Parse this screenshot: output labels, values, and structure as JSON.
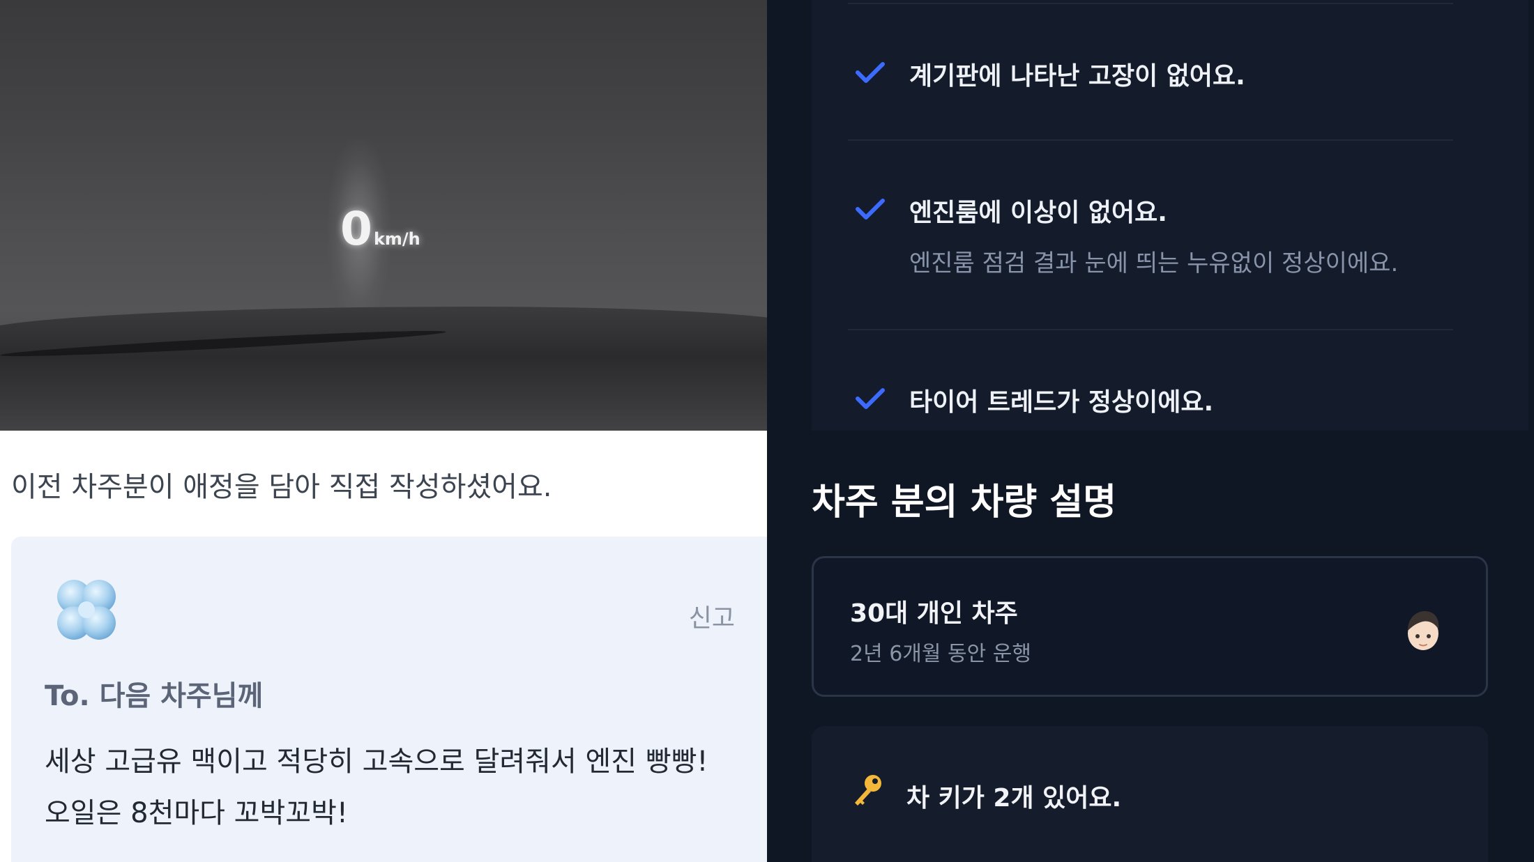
{
  "photo": {
    "hud_speed": "0",
    "hud_unit": "km/h"
  },
  "letter": {
    "intro": "이전 차주분이 애정을 담아 직접 작성하셨어요.",
    "report_label": "신고",
    "to": "To. 다음 차주님께",
    "message_lines": [
      "세상 고급유 맥이고 적당히 고속으로 달려줘서 엔진 빵빵!",
      "오일은 8천마다 꼬박꼬박!"
    ],
    "icon": "clover-icon"
  },
  "checklist": {
    "items": [
      {
        "title": "계기판에 나타난 고장이 없어요.",
        "description": ""
      },
      {
        "title": "엔진룸에 이상이 없어요.",
        "description": "엔진룸 점검 결과 눈에 띄는 누유없이 정상이에요."
      },
      {
        "title": "타이어 트레드가 정상이에요.",
        "description": ""
      }
    ],
    "check_color": "#3d6bff"
  },
  "owner": {
    "section_title": "차주 분의 차량 설명",
    "owner_card": {
      "name": "30대 개인 차주",
      "period": "2년 6개월 동안 운행",
      "icon": "avatar-icon"
    },
    "key_card": {
      "text": "차 키가 2개 있어요.",
      "icon": "key-icon"
    }
  }
}
